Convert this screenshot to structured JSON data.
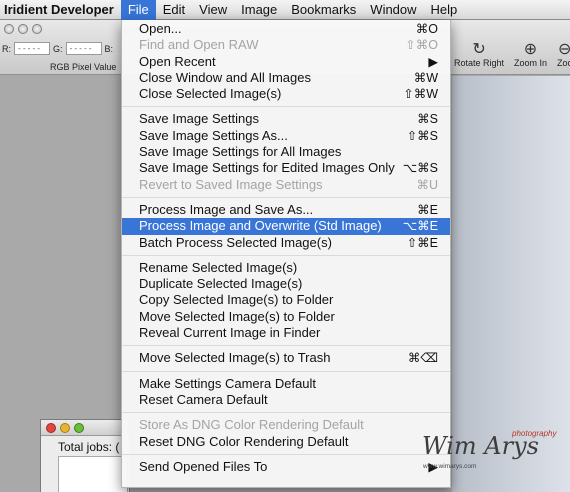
{
  "menubar": {
    "app": "Iridient Developer",
    "items": [
      "File",
      "Edit",
      "View",
      "Image",
      "Bookmarks",
      "Window",
      "Help"
    ]
  },
  "toolbar": {
    "rgb_fields": [
      {
        "label": "R:",
        "value": "-----"
      },
      {
        "label": "G:",
        "value": "-----"
      },
      {
        "label": "B:",
        "value": ""
      }
    ],
    "rgb_caption": "RGB Pixel Value",
    "buttons": [
      {
        "label": "Rotate Right",
        "icon": "rotate-right-icon"
      },
      {
        "label": "Zoom In",
        "icon": "zoom-in-icon"
      },
      {
        "label": "Zoo",
        "icon": "zoom-icon"
      }
    ]
  },
  "file_menu": {
    "groups": [
      [
        {
          "label": "Open...",
          "shortcut": "⌘O",
          "disabled": false
        },
        {
          "label": "Find and Open RAW",
          "shortcut": "⇧⌘O",
          "disabled": true
        },
        {
          "label": "Open Recent",
          "shortcut": "▶",
          "disabled": false
        },
        {
          "label": "Close Window and All Images",
          "shortcut": "⌘W",
          "disabled": false
        },
        {
          "label": "Close Selected Image(s)",
          "shortcut": "⇧⌘W",
          "disabled": false
        }
      ],
      [
        {
          "label": "Save Image Settings",
          "shortcut": "⌘S",
          "disabled": false
        },
        {
          "label": "Save Image Settings As...",
          "shortcut": "⇧⌘S",
          "disabled": false
        },
        {
          "label": "Save Image Settings for All Images",
          "shortcut": "",
          "disabled": false
        },
        {
          "label": "Save Image Settings for Edited Images Only",
          "shortcut": "⌥⌘S",
          "disabled": false
        },
        {
          "label": "Revert to Saved Image Settings",
          "shortcut": "⌘U",
          "disabled": true
        }
      ],
      [
        {
          "label": "Process Image and Save As...",
          "shortcut": "⌘E",
          "disabled": false
        },
        {
          "label": "Process Image and Overwrite (Std Image)",
          "shortcut": "⌥⌘E",
          "disabled": false,
          "selected": true
        },
        {
          "label": "Batch Process Selected Image(s)",
          "shortcut": "⇧⌘E",
          "disabled": false
        }
      ],
      [
        {
          "label": "Rename Selected Image(s)",
          "shortcut": "",
          "disabled": false
        },
        {
          "label": "Duplicate Selected Image(s)",
          "shortcut": "",
          "disabled": false
        },
        {
          "label": "Copy Selected Image(s) to Folder",
          "shortcut": "",
          "disabled": false
        },
        {
          "label": "Move Selected Image(s) to Folder",
          "shortcut": "",
          "disabled": false
        },
        {
          "label": "Reveal Current Image in Finder",
          "shortcut": "",
          "disabled": false
        }
      ],
      [
        {
          "label": "Move Selected Image(s) to Trash",
          "shortcut": "⌘⌫",
          "disabled": false
        }
      ],
      [
        {
          "label": "Make Settings Camera Default",
          "shortcut": "",
          "disabled": false
        },
        {
          "label": "Reset Camera Default",
          "shortcut": "",
          "disabled": false
        }
      ],
      [
        {
          "label": "Store As DNG Color Rendering Default",
          "shortcut": "",
          "disabled": true
        },
        {
          "label": "Reset DNG Color Rendering Default",
          "shortcut": "",
          "disabled": false
        }
      ],
      [
        {
          "label": "Send Opened Files To",
          "shortcut": "▶",
          "disabled": false
        }
      ]
    ]
  },
  "jobs_window": {
    "total_label": "Total jobs: ("
  },
  "watermark": {
    "name": "Wim Arys",
    "tag": "photography",
    "url": "www.wimarys.com"
  },
  "colors": {
    "selection": "#3875d7",
    "disabled_text": "#a4a4a4",
    "watermark_tag": "#b53a2a"
  }
}
